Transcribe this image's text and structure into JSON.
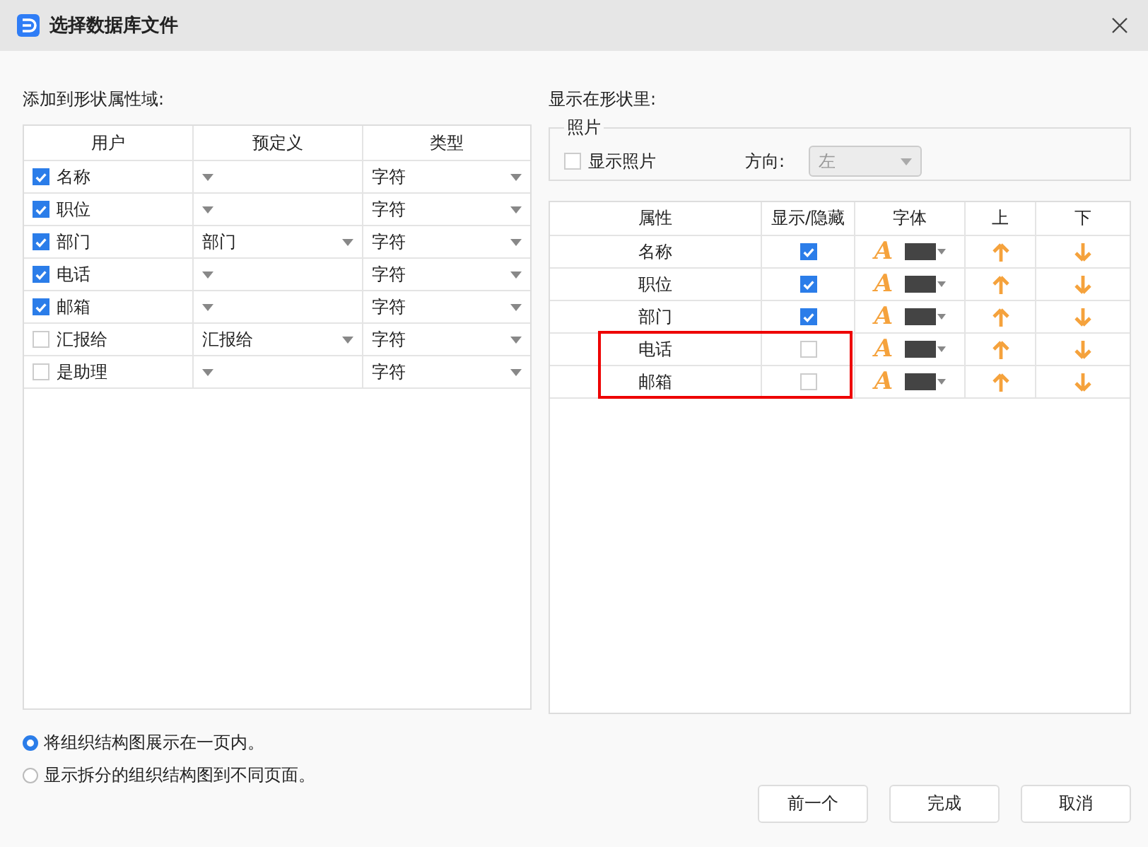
{
  "window": {
    "title": "选择数据库文件"
  },
  "left": {
    "label": "添加到形状属性域:",
    "columns": [
      "用户",
      "预定义",
      "类型"
    ],
    "rows": [
      {
        "checked": true,
        "name": "名称",
        "predefined": "",
        "type": "字符"
      },
      {
        "checked": true,
        "name": "职位",
        "predefined": "",
        "type": "字符"
      },
      {
        "checked": true,
        "name": "部门",
        "predefined": "部门",
        "type": "字符"
      },
      {
        "checked": true,
        "name": "电话",
        "predefined": "",
        "type": "字符"
      },
      {
        "checked": true,
        "name": "邮箱",
        "predefined": "",
        "type": "字符"
      },
      {
        "checked": false,
        "name": "汇报给",
        "predefined": "汇报给",
        "type": "字符"
      },
      {
        "checked": false,
        "name": "是助理",
        "predefined": "",
        "type": "字符"
      }
    ]
  },
  "right": {
    "label": "显示在形状里:",
    "photo": {
      "title": "照片",
      "show_label": "显示照片",
      "checked": false,
      "direction_label": "方向:",
      "direction": "左",
      "disabled": true
    },
    "columns": [
      "属性",
      "显示/隐藏",
      "字体",
      "上",
      "下"
    ],
    "rows": [
      {
        "name": "名称",
        "visible": true,
        "font_icon": "A",
        "highlighted": false
      },
      {
        "name": "职位",
        "visible": true,
        "font_icon": "A",
        "highlighted": false
      },
      {
        "name": "部门",
        "visible": true,
        "font_icon": "A",
        "highlighted": false
      },
      {
        "name": "电话",
        "visible": false,
        "font_icon": "A",
        "highlighted": true
      },
      {
        "name": "邮箱",
        "visible": false,
        "font_icon": "A",
        "highlighted": true
      }
    ]
  },
  "options": [
    {
      "label": "将组织结构图展示在一页内。",
      "selected": true
    },
    {
      "label": "显示拆分的组织结构图到不同页面。",
      "selected": false
    }
  ],
  "buttons": [
    "前一个",
    "完成",
    "取消"
  ]
}
